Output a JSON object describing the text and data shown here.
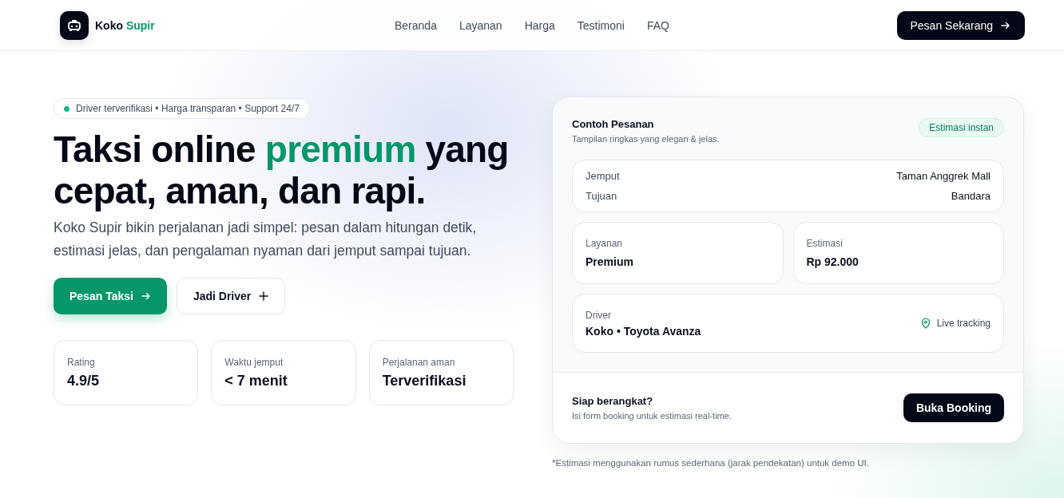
{
  "brand": {
    "name": "Koko",
    "accent": "Supir"
  },
  "nav": [
    {
      "label": "Beranda"
    },
    {
      "label": "Layanan"
    },
    {
      "label": "Harga"
    },
    {
      "label": "Testimoni"
    },
    {
      "label": "FAQ"
    }
  ],
  "header_button": "Pesan Sekarang",
  "hero": {
    "badge": "Driver terverifikasi • Harga transparan • Support 24/7",
    "heading": {
      "before": "Taksi online ",
      "highlight": "premium",
      "after": " yang cepat, aman, dan rapi."
    },
    "description": "Koko Supir bikin perjalanan jadi simpel: pesan dalam hitungan detik, estimasi jelas, dan pengalaman nyaman dari jemput sampai tujuan.",
    "buttons": [
      {
        "label": "Pesan Taksi",
        "kind": "primary"
      },
      {
        "label": "Jadi Driver",
        "kind": "secondary"
      }
    ],
    "stats": [
      {
        "label": "Rating",
        "value": "4.9/5"
      },
      {
        "label": "Waktu jemput",
        "value": "< 7 menit"
      },
      {
        "label": "Perjalanan aman",
        "value": "Terverifikasi"
      }
    ]
  },
  "order_card": {
    "title": "Contoh Pesanan",
    "subtitle": "Tampilan ringkas yang elegan & jelas.",
    "tag": "Estimasi instan",
    "route": [
      {
        "label": "Jemput",
        "value": "Taman Anggrek Mall"
      },
      {
        "label": "Tujuan",
        "value": "Bandara"
      }
    ],
    "details": [
      {
        "label": "Layanan",
        "value": "Premium"
      },
      {
        "label": "Estimasi",
        "value": "Rp 92.000"
      }
    ],
    "driver": {
      "label": "Driver",
      "value": "Koko • Toyota Avanza",
      "status": "Live tracking"
    },
    "footer": {
      "title": "Siap berangkat?",
      "text": "Isi form booking untuk estimasi real-time.",
      "button": "Buka Booking"
    }
  },
  "footnote": "*Estimasi menggunakan rumus sederhana (jarak pendekatan) untuk demo UI."
}
